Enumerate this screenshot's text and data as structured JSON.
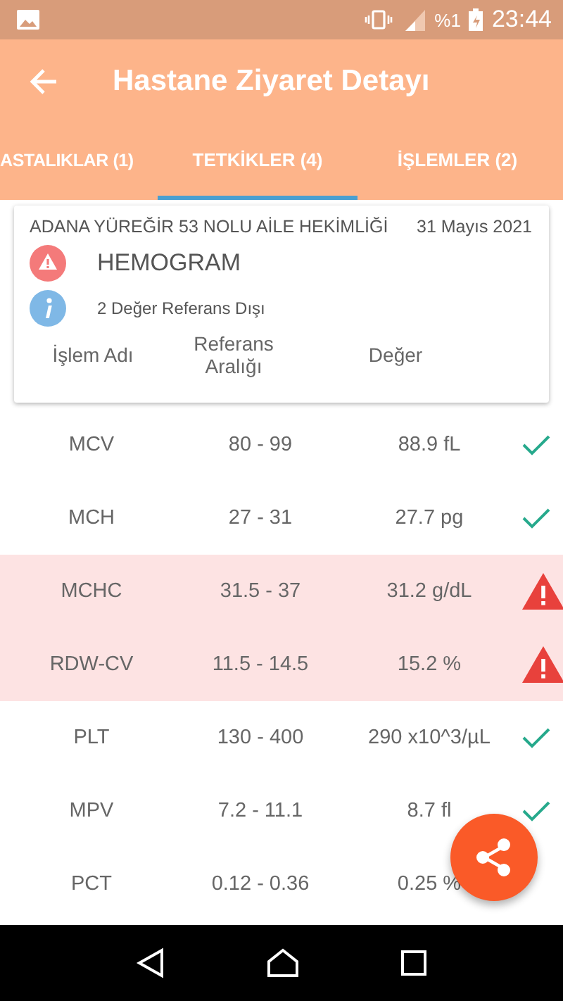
{
  "status_bar": {
    "battery_text": "%1",
    "time": "23:44"
  },
  "app_bar": {
    "title": "Hastane Ziyaret Detayı"
  },
  "tabs": [
    {
      "label": "ASTALIKLAR (1)",
      "selected": false
    },
    {
      "label": "TETKİKLER (4)",
      "selected": true
    },
    {
      "label": "İŞLEMLER (2)",
      "selected": false
    }
  ],
  "card": {
    "facility": "ADANA YÜREĞİR 53 NOLU AİLE HEKİMLİĞİ",
    "date": "31 Mayıs 2021",
    "test_name": "HEMOGRAM",
    "info": "2 Değer Referans Dışı",
    "columns": [
      "İşlem Adı",
      "Referans Aralığı",
      "Değer"
    ]
  },
  "rows": [
    {
      "name": "MCV",
      "range": "80 - 99",
      "value": "88.9 fL",
      "out_of_range": false,
      "icon_visible": true
    },
    {
      "name": "MCH",
      "range": "27 - 31",
      "value": "27.7 pg",
      "out_of_range": false,
      "icon_visible": true
    },
    {
      "name": "MCHC",
      "range": "31.5 - 37",
      "value": "31.2 g/dL",
      "out_of_range": true,
      "icon_visible": true
    },
    {
      "name": "RDW-CV",
      "range": "11.5 - 14.5",
      "value": "15.2 %",
      "out_of_range": true,
      "icon_visible": true
    },
    {
      "name": "PLT",
      "range": "130 - 400",
      "value": "290 x10^3/µL",
      "out_of_range": false,
      "icon_visible": true
    },
    {
      "name": "MPV",
      "range": "7.2 - 11.1",
      "value": "8.7 fl",
      "out_of_range": false,
      "icon_visible": true
    },
    {
      "name": "PCT",
      "range": "0.12 - 0.36",
      "value": "0.25 %",
      "out_of_range": false,
      "icon_visible": false
    }
  ]
}
